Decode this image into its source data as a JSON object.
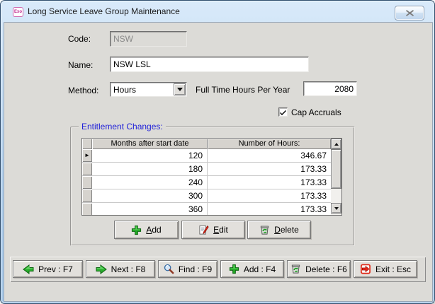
{
  "window": {
    "title": "Long Service Leave Group Maintenance",
    "app_badge": "Exo"
  },
  "form": {
    "code_label": "Code:",
    "code_value": "NSW",
    "name_label": "Name:",
    "name_value": "NSW LSL",
    "method_label": "Method:",
    "method_value": "Hours",
    "full_time_hours_label": "Full Time Hours Per Year",
    "full_time_hours_value": "2080",
    "cap_accruals_label": "Cap Accruals",
    "cap_accruals_checked": true
  },
  "entitlement": {
    "group_label": "Entitlement Changes:",
    "columns": [
      "Months after start date",
      "Number of Hours:"
    ],
    "rows": [
      {
        "months": "120",
        "hours": "346.67",
        "current": true
      },
      {
        "months": "180",
        "hours": "173.33",
        "current": false
      },
      {
        "months": "240",
        "hours": "173.33",
        "current": false
      },
      {
        "months": "300",
        "hours": "173.33",
        "current": false
      },
      {
        "months": "360",
        "hours": "173.33",
        "current": false
      }
    ],
    "add_label": "Add",
    "edit_label": "Edit",
    "delete_label": "Delete"
  },
  "toolbar": {
    "prev_label": "Prev : F7",
    "next_label": "Next : F8",
    "find_label": "Find : F9",
    "add_label": "Add : F4",
    "delete_label": "Delete : F6",
    "exit_label": "Exit : Esc"
  },
  "colors": {
    "group_label_blue": "#2222d8",
    "accent_green": "#23a826",
    "accent_red": "#e02412",
    "titlebar_blue": "#bdd7f0",
    "client_gray": "#dcdbd7"
  }
}
